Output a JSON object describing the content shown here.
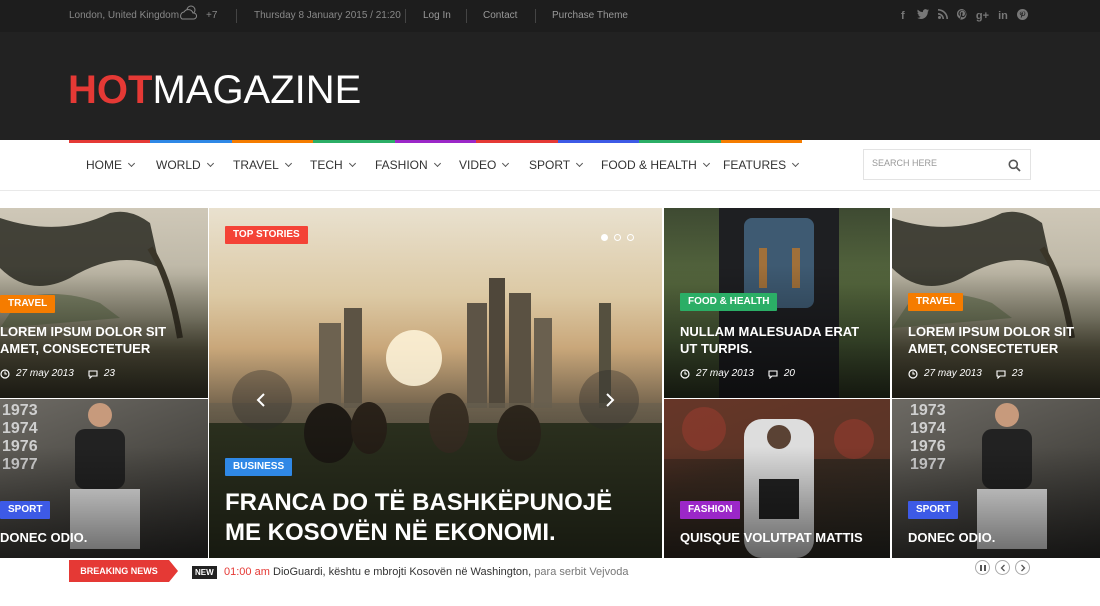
{
  "topbar": {
    "location": "London, United Kingdom",
    "temperature": "+7",
    "datetime": "Thursday 8 January 2015 / 21:20",
    "login": "Log In",
    "contact": "Contact",
    "purchase": "Purchase Theme",
    "social": [
      "facebook-icon",
      "twitter-icon",
      "rss-icon",
      "pinterest-icon",
      "google-plus-icon",
      "linkedin-icon",
      "pinterest-icon"
    ]
  },
  "logo": {
    "hot": "HOT",
    "magazine": "MAGAZINE"
  },
  "nav": {
    "items": [
      "HOME",
      "WORLD",
      "TRAVEL",
      "TECH",
      "FASHION",
      "VIDEO",
      "SPORT",
      "FOOD & HEALTH",
      "FEATURES"
    ],
    "colors": [
      "#e53935",
      "#2f88e6",
      "#f57c00",
      "#2bae66",
      "#9b27c8",
      "#e53935",
      "#3d5ae6",
      "#2bae66",
      "#f57c00"
    ],
    "search_placeholder": "SEARCH HERE"
  },
  "tiles": {
    "left_top": {
      "category": "TRAVEL",
      "title": "LOREM IPSUM DOLOR SIT AMET, CONSECTETUER",
      "date": "27 may 2013",
      "comments": "23"
    },
    "left_bottom": {
      "category": "SPORT",
      "title": "DONEC ODIO."
    },
    "main": {
      "top_badge": "TOP STORIES",
      "category": "BUSINESS",
      "title": "FRANCA DO TË BASHKËPUNOJË ME KOSOVËN NË EKONOMI."
    },
    "right1_top": {
      "category": "FOOD & HEALTH",
      "title": "NULLAM MALESUADA ERAT UT TURPIS.",
      "date": "27 may 2013",
      "comments": "20"
    },
    "right1_bottom": {
      "category": "FASHION",
      "title": "QUISQUE VOLUTPAT MATTIS"
    },
    "right2_top": {
      "category": "TRAVEL",
      "title": "LOREM IPSUM DOLOR SIT AMET, CONSECTETUER",
      "date": "27 may 2013",
      "comments": "23"
    },
    "right2_bottom": {
      "category": "SPORT",
      "title": "DONEC ODIO."
    }
  },
  "breaking": {
    "label": "BREAKING NEWS",
    "new_badge": "NEW",
    "time": "01:00 am",
    "headline": "DioGuardi, kështu e mbrojti Kosovën në Washington,",
    "headline_rest": " para serbit Vejvoda"
  }
}
